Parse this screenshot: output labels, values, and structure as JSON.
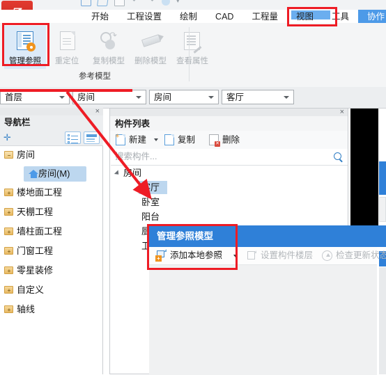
{
  "app": {
    "logo_letter": "Z",
    "logo_color": "#d4302a",
    "accent_color": "#2f80d8"
  },
  "quick_access": {
    "icons": [
      "new-icon",
      "edit-icon",
      "save-icon",
      "undo-icon",
      "redo-icon",
      "cloud-icon",
      "customize-icon"
    ]
  },
  "tabs": {
    "items": [
      {
        "label": "开始",
        "active": false
      },
      {
        "label": "工程设置",
        "active": false
      },
      {
        "label": "绘制",
        "active": false
      },
      {
        "label": "CAD",
        "active": false
      },
      {
        "label": "工程量",
        "active": false
      },
      {
        "label": "视图",
        "active": false
      },
      {
        "label": "工具",
        "active": false
      },
      {
        "label": "协作",
        "active": true
      }
    ]
  },
  "ribbon": {
    "group_label": "参考模型",
    "buttons": [
      {
        "label": "管理参照",
        "icon": "manage-reference-icon",
        "enabled": true,
        "selected": true
      },
      {
        "label": "重定位",
        "icon": "relocate-icon",
        "enabled": false,
        "selected": false
      },
      {
        "label": "复制模型",
        "icon": "copy-model-icon",
        "enabled": false,
        "selected": false
      },
      {
        "label": "删除模型",
        "icon": "delete-model-icon",
        "enabled": false,
        "selected": false
      },
      {
        "label": "查看属性",
        "icon": "view-properties-icon",
        "enabled": false,
        "selected": false
      }
    ]
  },
  "dropdown_bar": {
    "combos": [
      {
        "name": "floor-select",
        "value": "首层"
      },
      {
        "name": "category-select",
        "value": "房间"
      },
      {
        "name": "component-type-select",
        "value": "房间"
      },
      {
        "name": "component-select",
        "value": "客厅"
      }
    ]
  },
  "nav_panel": {
    "title": "导航栏",
    "close_label": "×",
    "add_icon": "add-plus-icon",
    "view_buttons": [
      "list-view-icon",
      "detail-view-icon"
    ],
    "tree": [
      {
        "label": "房间",
        "icon": "folder-open-icon",
        "expander": "−",
        "level": 0,
        "selected": false
      },
      {
        "label": "房间(M)",
        "icon": "home-icon",
        "level": 1,
        "selected": true
      },
      {
        "label": "楼地面工程",
        "icon": "folder-icon",
        "expander": "+",
        "level": 0,
        "selected": false
      },
      {
        "label": "天棚工程",
        "icon": "folder-icon",
        "expander": "+",
        "level": 0,
        "selected": false
      },
      {
        "label": "墙柱面工程",
        "icon": "folder-icon",
        "expander": "+",
        "level": 0,
        "selected": false
      },
      {
        "label": "门窗工程",
        "icon": "folder-icon",
        "expander": "+",
        "level": 0,
        "selected": false
      },
      {
        "label": "零星装修",
        "icon": "folder-icon",
        "expander": "+",
        "level": 0,
        "selected": false
      },
      {
        "label": "自定义",
        "icon": "folder-icon",
        "expander": "+",
        "level": 0,
        "selected": false
      },
      {
        "label": "轴线",
        "icon": "folder-icon",
        "expander": "+",
        "level": 0,
        "selected": false
      }
    ]
  },
  "component_list": {
    "title": "构件列表",
    "close_label": "×",
    "toolbar": [
      {
        "label": "新建",
        "icon": "new-document-icon",
        "has_dropdown": true
      },
      {
        "label": "复制",
        "icon": "copy-document-icon",
        "has_dropdown": false
      },
      {
        "label": "删除",
        "icon": "delete-document-icon",
        "has_dropdown": false
      }
    ],
    "search": {
      "placeholder": "搜索构件...",
      "icon": "search-icon",
      "value": ""
    },
    "tree": [
      {
        "label": "房间",
        "level": 0,
        "expanded": true,
        "selected": false
      },
      {
        "label": "客厅",
        "level": 1,
        "expanded": false,
        "selected": true
      },
      {
        "label": "卧室",
        "level": 1,
        "expanded": false,
        "selected": false
      },
      {
        "label": "阳台",
        "level": 1,
        "expanded": false,
        "selected": false
      },
      {
        "label": "厨房",
        "level": 1,
        "expanded": false,
        "selected": false
      },
      {
        "label": "卫生间",
        "level": 1,
        "expanded": false,
        "selected": false
      }
    ]
  },
  "dialog": {
    "title": "管理参照模型",
    "toolbar": [
      {
        "label": "添加本地参照",
        "icon": "add-local-reference-icon",
        "enabled": true,
        "has_dropdown": true
      },
      {
        "label": "设置构件楼层",
        "icon": "set-component-floor-icon",
        "enabled": false,
        "has_dropdown": false
      },
      {
        "label": "检查更新状态",
        "icon": "check-update-status-icon",
        "enabled": false,
        "has_dropdown": false
      }
    ]
  },
  "annotations": {
    "color": "#ee1c25",
    "boxes": [
      {
        "name": "highlight-tab-collaboration"
      },
      {
        "name": "highlight-manage-reference-button"
      },
      {
        "name": "highlight-add-local-reference"
      }
    ],
    "arrows": [
      {
        "name": "arrow-to-component-tree"
      }
    ]
  }
}
